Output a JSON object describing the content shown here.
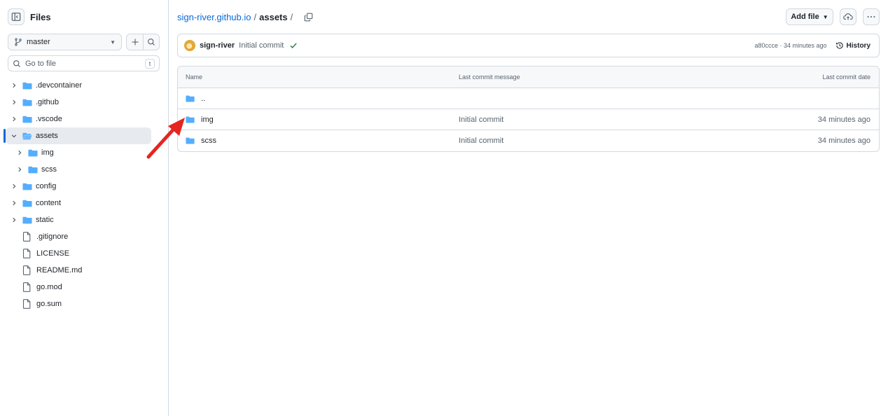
{
  "sidebar": {
    "title": "Files",
    "branch": "master",
    "goto_placeholder": "Go to file",
    "goto_shortcut": "t",
    "tree": [
      {
        "label": ".devcontainer",
        "type": "folder",
        "expanded": false,
        "depth": 0
      },
      {
        "label": ".github",
        "type": "folder",
        "expanded": false,
        "depth": 0
      },
      {
        "label": ".vscode",
        "type": "folder",
        "expanded": false,
        "depth": 0
      },
      {
        "label": "assets",
        "type": "folder",
        "expanded": true,
        "depth": 0,
        "active": true
      },
      {
        "label": "img",
        "type": "folder",
        "expanded": false,
        "depth": 1
      },
      {
        "label": "scss",
        "type": "folder",
        "expanded": false,
        "depth": 1
      },
      {
        "label": "config",
        "type": "folder",
        "expanded": false,
        "depth": 0
      },
      {
        "label": "content",
        "type": "folder",
        "expanded": false,
        "depth": 0
      },
      {
        "label": "static",
        "type": "folder",
        "expanded": false,
        "depth": 0
      },
      {
        "label": ".gitignore",
        "type": "file",
        "depth": 0
      },
      {
        "label": "LICENSE",
        "type": "file",
        "depth": 0
      },
      {
        "label": "README.md",
        "type": "file",
        "depth": 0
      },
      {
        "label": "go.mod",
        "type": "file",
        "depth": 0
      },
      {
        "label": "go.sum",
        "type": "file",
        "depth": 0
      }
    ]
  },
  "breadcrumb": {
    "repo": "sign-river.github.io",
    "sep1": "/",
    "current": "assets",
    "sep2": "/"
  },
  "toolbar": {
    "add_file_label": "Add file"
  },
  "commit": {
    "author": "sign-river",
    "message": "Initial commit",
    "meta": "a80ccce · 34 minutes ago",
    "history_label": "History"
  },
  "table": {
    "headers": {
      "name": "Name",
      "message": "Last commit message",
      "date": "Last commit date"
    },
    "rows": [
      {
        "name": "..",
        "message": "",
        "date": ""
      },
      {
        "name": "img",
        "message": "Initial commit",
        "date": "34 minutes ago"
      },
      {
        "name": "scss",
        "message": "Initial commit",
        "date": "34 minutes ago"
      }
    ]
  },
  "colors": {
    "accent": "#0969da",
    "folder": "#54aeff",
    "success": "#1a7f37",
    "annotation_arrow": "#e5251f"
  }
}
